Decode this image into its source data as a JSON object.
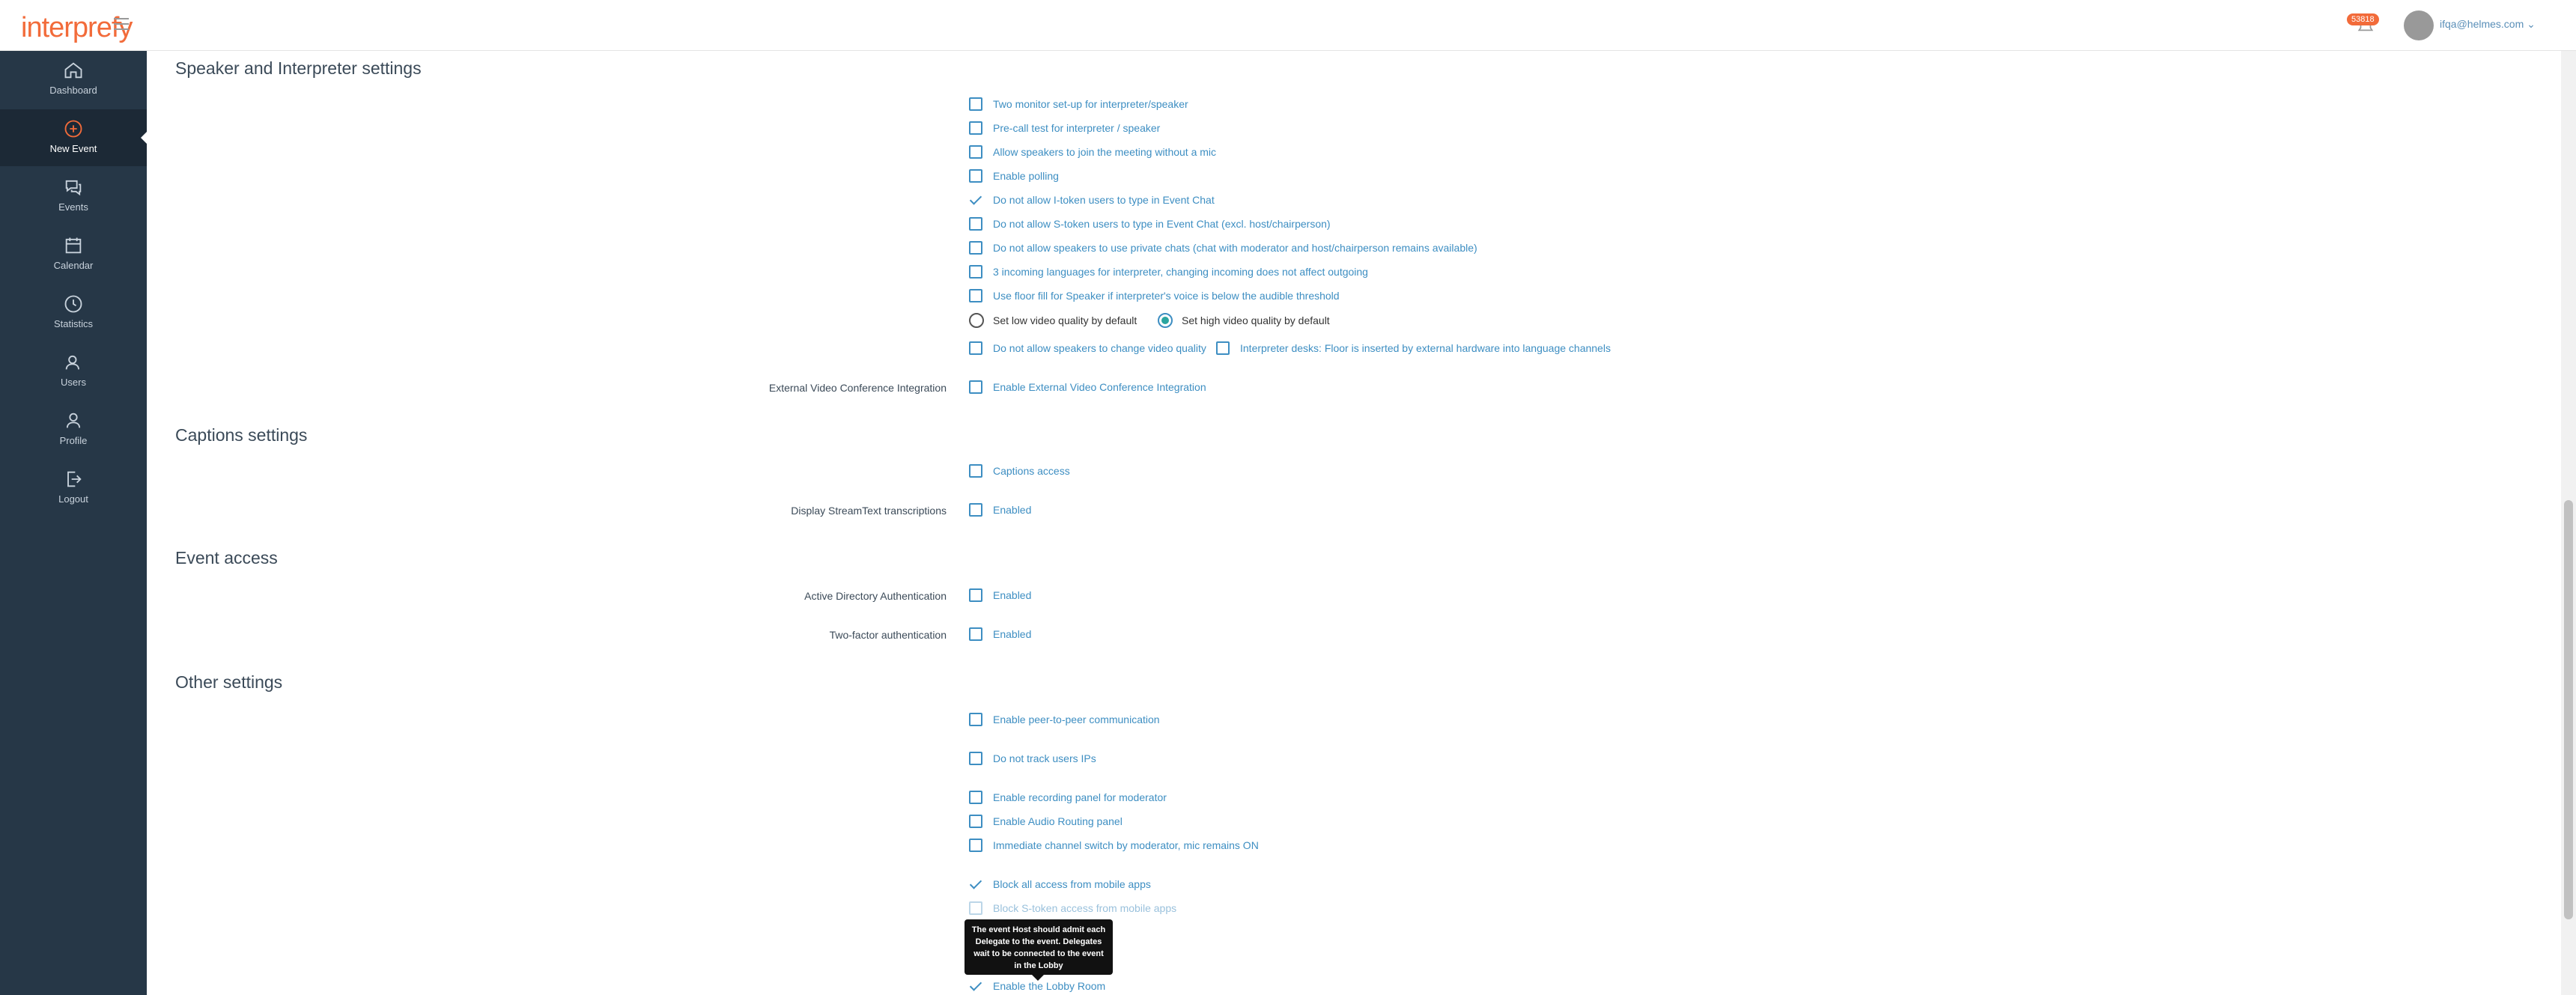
{
  "app": {
    "logo": "interprefy"
  },
  "header": {
    "badge": "53818",
    "user_email": "ifqa@helmes.com ⌄"
  },
  "sidebar": {
    "items": [
      {
        "label": "Dashboard",
        "icon": "home-icon"
      },
      {
        "label": "New Event",
        "icon": "plus-circle-icon",
        "active": true
      },
      {
        "label": "Events",
        "icon": "chat-bubbles-icon"
      },
      {
        "label": "Calendar",
        "icon": "calendar-icon"
      },
      {
        "label": "Statistics",
        "icon": "clock-icon"
      },
      {
        "label": "Users",
        "icon": "users-icon"
      },
      {
        "label": "Profile",
        "icon": "person-icon"
      },
      {
        "label": "Logout",
        "icon": "logout-icon"
      }
    ]
  },
  "sections": {
    "speaker": {
      "title": "Speaker and Interpreter settings",
      "options": [
        {
          "label": "Two monitor set-up for interpreter/speaker",
          "checked": false
        },
        {
          "label": "Pre-call test for interpreter / speaker",
          "checked": false
        },
        {
          "label": "Allow speakers to join the meeting without a mic",
          "checked": false
        },
        {
          "label": "Enable polling",
          "checked": false
        },
        {
          "label": "Do not allow I-token users to type in Event Chat",
          "checked": true
        },
        {
          "label": "Do not allow S-token users to type in Event Chat (excl. host/chairperson)",
          "checked": false
        },
        {
          "label": "Do not allow speakers to use private chats (chat with moderator and host/chairperson remains available)",
          "checked": false
        },
        {
          "label": "3 incoming languages for interpreter, changing incoming does not affect outgoing",
          "checked": false
        },
        {
          "label": "Use floor fill for Speaker if interpreter's voice is below the audible threshold",
          "checked": false
        }
      ],
      "radio_low": "Set low video quality by default",
      "radio_high": "Set high video quality by default",
      "video_change": "Do not allow speakers to change video quality",
      "interpreter_desks": "Interpreter desks: Floor is inserted by external hardware into language channels",
      "external_label": "External Video Conference Integration",
      "external_option": "Enable External Video Conference Integration"
    },
    "captions": {
      "title": "Captions settings",
      "access": "Captions access",
      "streamtext_label": "Display StreamText transcriptions",
      "streamtext_option": "Enabled"
    },
    "access": {
      "title": "Event access",
      "ad_label": "Active Directory Authentication",
      "ad_option": "Enabled",
      "twofa_label": "Two-factor authentication",
      "twofa_option": "Enabled"
    },
    "other": {
      "title": "Other settings",
      "p2p": "Enable peer-to-peer communication",
      "track_ips": "Do not track users IPs",
      "recording": "Enable recording panel for moderator",
      "audio_routing": "Enable Audio Routing panel",
      "channel_switch": "Immediate channel switch by moderator, mic remains ON",
      "block_mobile": "Block all access from mobile apps",
      "block_s_token": "Block S-token access from mobile apps",
      "lobby": "Enable the Lobby Room"
    }
  },
  "tooltip": "The event Host should admit each Delegate to the event. Delegates wait to be connected to the event in the Lobby"
}
